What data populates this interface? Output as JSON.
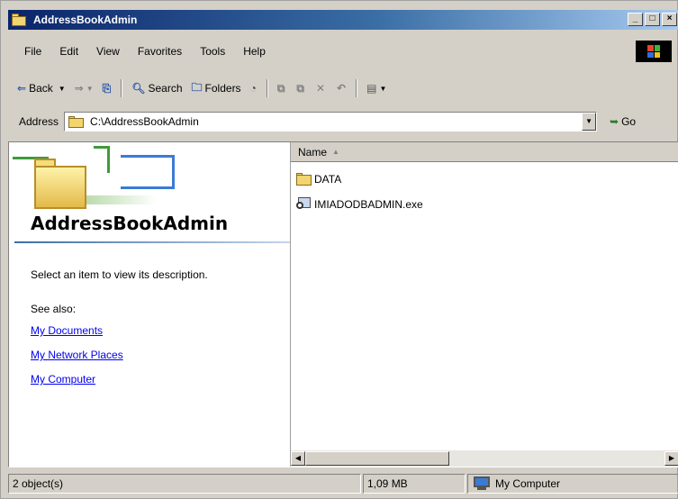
{
  "window": {
    "title": "AddressBookAdmin"
  },
  "menu": [
    "File",
    "Edit",
    "View",
    "Favorites",
    "Tools",
    "Help"
  ],
  "toolbar": {
    "back": "Back",
    "search": "Search",
    "folders": "Folders"
  },
  "address": {
    "label": "Address",
    "value": "C:\\AddressBookAdmin",
    "go": "Go"
  },
  "left_pane": {
    "title": "AddressBookAdmin",
    "description": "Select an item to view its description.",
    "see_also": "See also:",
    "links": [
      "My Documents",
      "My Network Places",
      "My Computer"
    ]
  },
  "files": {
    "column_name": "Name",
    "items": [
      {
        "name": "DATA",
        "icon": "folder-icon"
      },
      {
        "name": "IMIADODBADMIN.exe",
        "icon": "exe-icon"
      }
    ]
  },
  "status": {
    "objects": "2 object(s)",
    "size": "1,09 MB",
    "zone": "My Computer"
  },
  "colors": {
    "titlebar": "#0a246a",
    "chrome": "#d4d0c8",
    "link": "#0000ee"
  }
}
